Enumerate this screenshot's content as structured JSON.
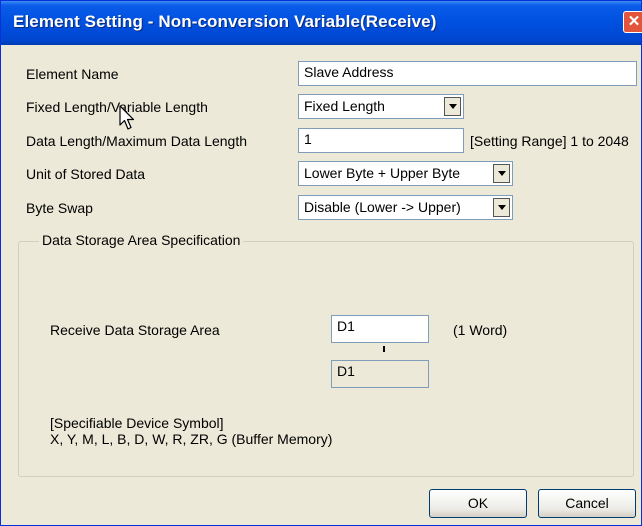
{
  "window": {
    "title": "Element Setting - Non-conversion Variable(Receive)",
    "close_glyph": "✕"
  },
  "fields": {
    "element_name": {
      "label": "Element Name",
      "value": "Slave Address"
    },
    "length_type": {
      "label": "Fixed Length/Variable Length",
      "value": "Fixed Length"
    },
    "data_length": {
      "label": "Data Length/Maximum Data Length",
      "value": "1",
      "range": "[Setting Range] 1 to 2048"
    },
    "unit": {
      "label": "Unit of Stored Data",
      "value": "Lower Byte + Upper Byte"
    },
    "byte_swap": {
      "label": "Byte Swap",
      "value": "Disable (Lower -> Upper)"
    }
  },
  "storage": {
    "group_title": "Data Storage Area Specification",
    "receive_label": "Receive Data Storage Area",
    "receive_value": "D1",
    "unit_note": "(1 Word)",
    "end_value": "D1",
    "device_header": "[Specifiable Device Symbol]",
    "device_list": "X, Y, M, L, B, D, W, R, ZR, G (Buffer Memory)"
  },
  "buttons": {
    "ok": "OK",
    "cancel": "Cancel"
  },
  "icons": {
    "cursor": "mouse-pointer-icon",
    "dropdown": "chevron-down-icon",
    "close": "close-icon"
  }
}
